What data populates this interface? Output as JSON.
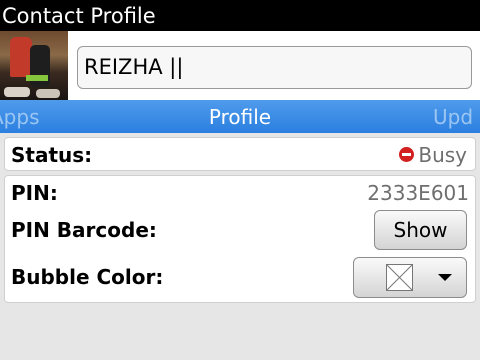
{
  "window": {
    "title": "Contact Profile"
  },
  "header": {
    "name_value": "REIZHA ||"
  },
  "tabs": {
    "left": "Apps",
    "active": "Profile",
    "right": "Upd"
  },
  "status": {
    "label": "Status:",
    "value": "Busy",
    "icon": "busy-icon",
    "icon_color": "#d21f1f"
  },
  "info": {
    "pin_label": "PIN:",
    "pin_value": "2333E601",
    "barcode_label": "PIN Barcode:",
    "barcode_button": "Show",
    "bubble_label": "Bubble Color:",
    "bubble_color_selected": "none",
    "bubble_icon": "empty-color-swatch-icon"
  },
  "colors": {
    "titlebar": "#000000",
    "tabbar": "#2b7fe0",
    "background": "#e6e6e6"
  }
}
